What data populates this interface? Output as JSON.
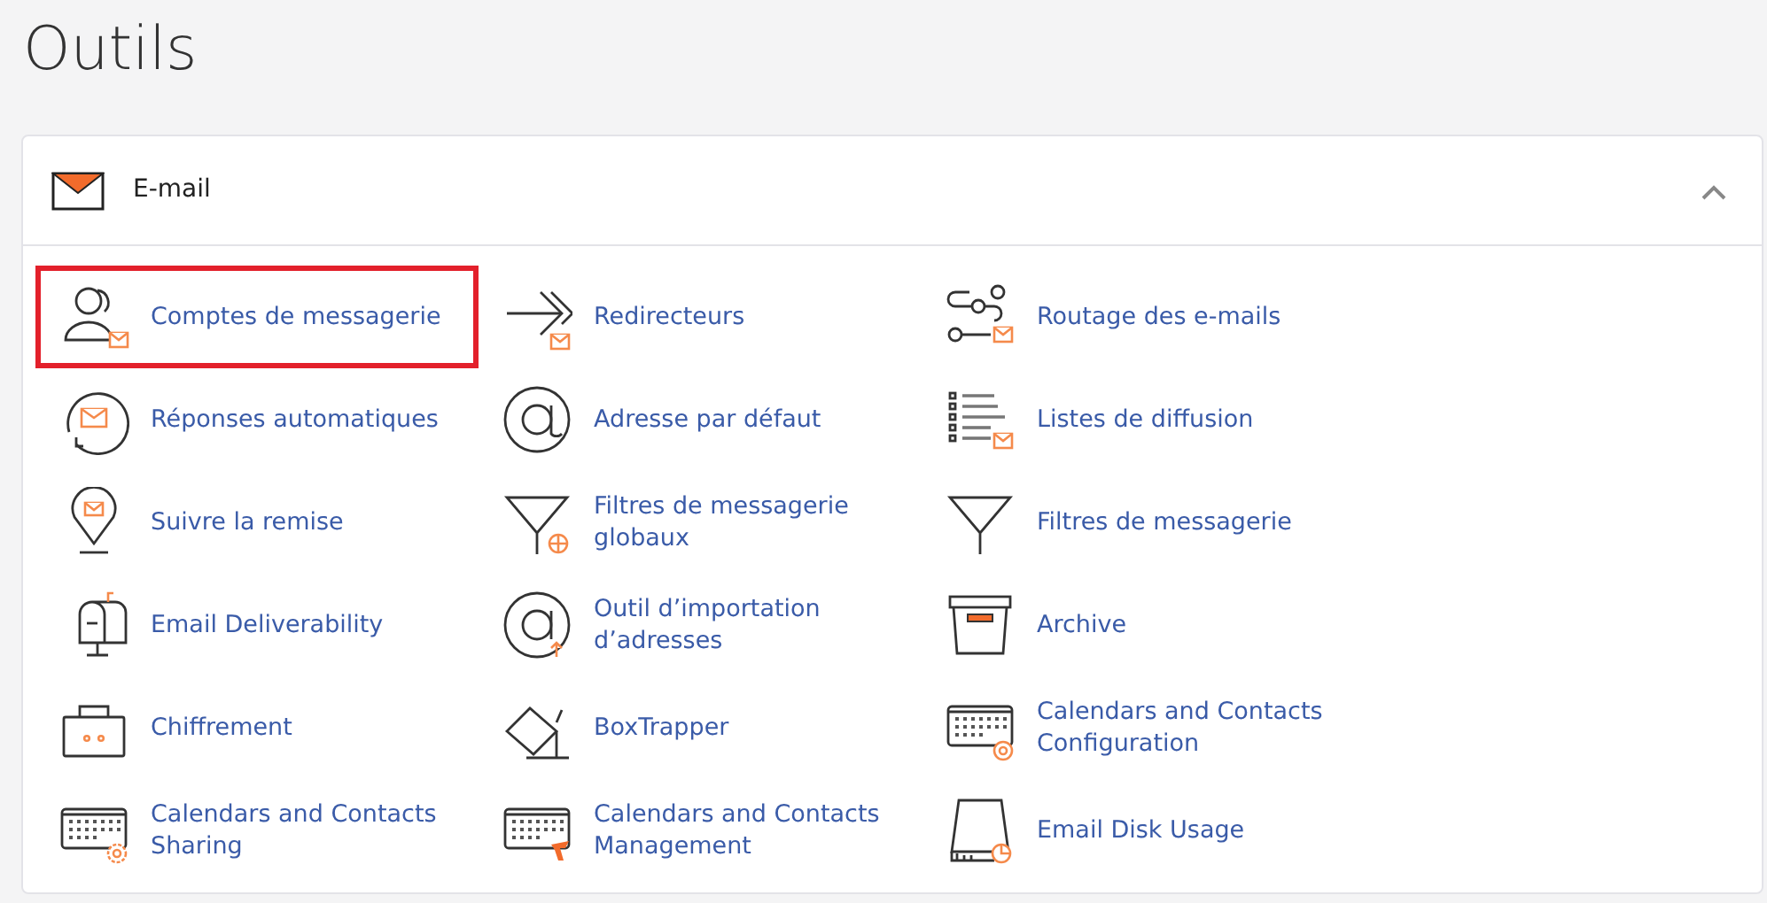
{
  "title": "Outils",
  "section": {
    "title": "E-mail",
    "expanded": true,
    "items": [
      {
        "label": "Comptes de messagerie",
        "selected": true
      },
      {
        "label": "Redirecteurs",
        "selected": false
      },
      {
        "label": "Routage des e-mails",
        "selected": false
      },
      {
        "label": "Réponses automatiques",
        "selected": false
      },
      {
        "label": "Adresse par défaut",
        "selected": false
      },
      {
        "label": "Listes de diffusion",
        "selected": false
      },
      {
        "label": "Suivre la remise",
        "selected": false
      },
      {
        "label": "Filtres de messagerie globaux",
        "selected": false
      },
      {
        "label": "Filtres de messagerie",
        "selected": false
      },
      {
        "label": "Email Deliverability",
        "selected": false
      },
      {
        "label": "Outil d’importation d’adresses",
        "selected": false
      },
      {
        "label": "Archive",
        "selected": false
      },
      {
        "label": "Chiffrement",
        "selected": false
      },
      {
        "label": "BoxTrapper",
        "selected": false
      },
      {
        "label": "Calendars and Contacts Configuration",
        "selected": false
      },
      {
        "label": "Calendars and Contacts Sharing",
        "selected": false
      },
      {
        "label": "Calendars and Contacts Management",
        "selected": false
      },
      {
        "label": "Email Disk Usage",
        "selected": false
      }
    ]
  }
}
